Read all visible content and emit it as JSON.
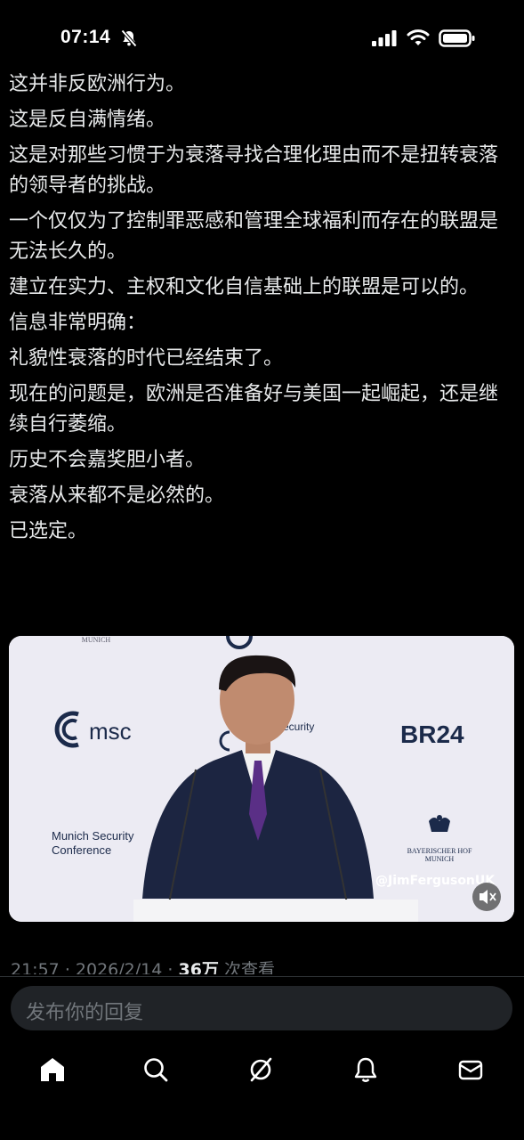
{
  "status_bar": {
    "time": "07:14",
    "icons": [
      "bell-slash-icon",
      "cellular-signal-icon",
      "wifi-icon",
      "battery-icon"
    ]
  },
  "post": {
    "paragraphs": [
      "这并非反欧洲行为。",
      "这是反自满情绪。",
      "这是对那些习惯于为衰落寻找合理化理由而不是扭转衰落的领导者的挑战。",
      "一个仅仅为了控制罪恶感和管理全球福利而存在的联盟是无法长久的。",
      "建立在实力、主权和文化自信基础上的联盟是可以的。",
      "信息非常明确：",
      "礼貌性衰落的时代已经结束了。",
      "现在的问题是，欧洲是否准备好与美国一起崛起，还是继续自行萎缩。",
      "历史不会嘉奖胆小者。",
      "衰落从来都不是必然的。",
      "已选定。"
    ]
  },
  "video": {
    "top_label": "MUNICH",
    "msc_text": "msc",
    "security_text": "Security",
    "conference_line1": "Munich Security",
    "conference_line2": "Conference",
    "br24_text": "BR24",
    "hotel_line1": "BAYERISCHER HOF",
    "hotel_line2": "MUNICH",
    "watermark": "@JimFergusonUK",
    "mute_icon": "speaker-muted-icon"
  },
  "meta": {
    "time": "21:57",
    "date": "2026/2/14",
    "views_count": "36万",
    "views_label": "次查看"
  },
  "reply": {
    "placeholder": "发布你的回复"
  },
  "tabs": [
    "home-icon",
    "search-icon",
    "grok-icon",
    "notifications-bell-icon",
    "messages-mail-icon"
  ],
  "colors": {
    "background": "#000000",
    "text": "#e7e9ea",
    "muted": "#71767b",
    "reply_bg": "#202327"
  }
}
